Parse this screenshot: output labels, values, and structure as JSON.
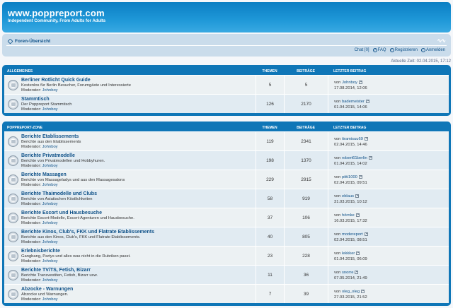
{
  "site": {
    "title": "www.poppreport.com",
    "subtitle": "Independent Community, From Adults for Adults"
  },
  "nav": {
    "breadcrumb": "Foren-Übersicht",
    "fontsize_glyph": "∿∿",
    "links": {
      "chat": "Chat [0]",
      "faq": "FAQ",
      "register": "Registrieren",
      "login": "Anmelden"
    }
  },
  "current_time": "Aktuelle Zeit: 02.04.2015, 17:12",
  "columns": {
    "topics": "Themen",
    "posts": "Beiträge",
    "last_post": "Letzter Beitrag"
  },
  "categories": [
    {
      "title": "Allgemeines",
      "forums": [
        {
          "title": "Berliner Rotlicht Quick Guide",
          "desc": "Kostenlos für Berlin Besucher, Forumgäste und Interessierte",
          "mod_label": "Moderator:",
          "mod": "Johnboy",
          "topics": "5",
          "posts": "5",
          "last_user": "Johnboy",
          "last_date": "17.08.2014, 12:06"
        },
        {
          "title": "Stammtisch",
          "desc": "Der Poppreport Stammtisch",
          "mod_label": "Moderator:",
          "mod": "Johnboy",
          "topics": "126",
          "posts": "2170",
          "last_user": "bademeister",
          "last_date": "01.04.2015, 14:06"
        }
      ]
    },
    {
      "title": "Poppreport-Zone",
      "forums": [
        {
          "title": "Berichte Etablissements",
          "desc": "Berichte aus den Etablissements",
          "mod_label": "Moderator:",
          "mod": "Johnboy",
          "topics": "119",
          "posts": "2341",
          "last_user": "tiramisuu69",
          "last_date": "02.04.2015, 14:46"
        },
        {
          "title": "Berichte Privatmodelle",
          "desc": "Berichte von Privatmodellen und Hobbyhuren.",
          "mod_label": "Moderator:",
          "mod": "Johnboy",
          "topics": "198",
          "posts": "1370",
          "last_user": "robert61berlin",
          "last_date": "01.04.2015, 14:02"
        },
        {
          "title": "Berichte Massagen",
          "desc": "Berichte von Massageladys und aus den Massagesalons",
          "mod_label": "Moderator:",
          "mod": "Johnboy",
          "topics": "229",
          "posts": "2915",
          "last_user": "pitti1000",
          "last_date": "02.04.2015, 09:51"
        },
        {
          "title": "Berichte Thaimodelle und Clubs",
          "desc": "Berichte von Asiatischen Köstlichkeiten",
          "mod_label": "Moderator:",
          "mod": "Johnboy",
          "topics": "58",
          "posts": "919",
          "last_user": "eblaus",
          "last_date": "31.03.2015, 10:12"
        },
        {
          "title": "Berichte Escort und Hausbesuche",
          "desc": "Berichte Escort-Modelle, Escort-Agenturen und Hausbesuche.",
          "mod_label": "Moderator:",
          "mod": "Johnboy",
          "topics": "37",
          "posts": "106",
          "last_user": "hörnke",
          "last_date": "16.03.2015, 17:32"
        },
        {
          "title": "Berichte Kinos, Club's, FKK und Flatrate Etablissements",
          "desc": "Berichte aus den Kinos, Club's, FKK und Flatrate Etablissements.",
          "mod_label": "Moderator:",
          "mod": "Johnboy",
          "topics": "40",
          "posts": "805",
          "last_user": "modereport",
          "last_date": "02.04.2015, 08:51"
        },
        {
          "title": "Erlebnisberichte",
          "desc": "Gangbang, Partys und alles was nicht in die Rubriken passt.",
          "mod_label": "Moderator:",
          "mod": "Johnboy",
          "topics": "23",
          "posts": "228",
          "last_user": "lekkker",
          "last_date": "01.04.2015, 06:09"
        },
        {
          "title": "Berichte TV/TS, Fetish, Bizarr",
          "desc": "Berichte Transvestiten, Fetish, Bizarr usw.",
          "mod_label": "Moderator:",
          "mod": "Johnboy",
          "topics": "11",
          "posts": "36",
          "last_user": "snorre",
          "last_date": "07.05.2014, 21:49"
        },
        {
          "title": "Abzocke - Warnungen",
          "desc": "Abzocke und Warnungen.",
          "mod_label": "Moderator:",
          "mod": "Johnboy",
          "topics": "7",
          "posts": "39",
          "last_user": "oleg_oleg",
          "last_date": "27.03.2015, 21:52"
        }
      ]
    }
  ],
  "last_by_label": "von",
  "colors": {
    "header": "#0b7fc4",
    "navbar": "#cadceb",
    "category": "#0f76b7",
    "link": "#105289"
  }
}
